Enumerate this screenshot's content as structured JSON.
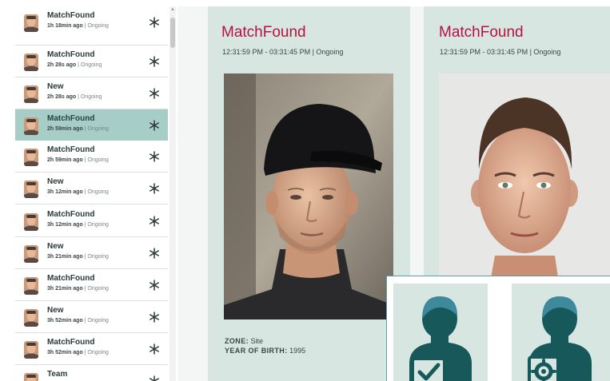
{
  "event_list": {
    "items": [
      {
        "title": "MatchFound",
        "ago": "1h 18min ago",
        "status": "Ongoing",
        "active": false
      },
      {
        "title": "MatchFound",
        "ago": "2h 28s ago",
        "status": "Ongoing",
        "active": false
      },
      {
        "title": "New",
        "ago": "2h 28s ago",
        "status": "Ongoing",
        "active": false
      },
      {
        "title": "MatchFound",
        "ago": "2h 59min ago",
        "status": "Ongoing",
        "active": true
      },
      {
        "title": "MatchFound",
        "ago": "2h 59min ago",
        "status": "Ongoing",
        "active": false
      },
      {
        "title": "New",
        "ago": "3h 12min ago",
        "status": "Ongoing",
        "active": false
      },
      {
        "title": "MatchFound",
        "ago": "3h 12min ago",
        "status": "Ongoing",
        "active": false
      },
      {
        "title": "New",
        "ago": "3h 21min ago",
        "status": "Ongoing",
        "active": false
      },
      {
        "title": "MatchFound",
        "ago": "3h 21min ago",
        "status": "Ongoing",
        "active": false
      },
      {
        "title": "New",
        "ago": "3h 52min ago",
        "status": "Ongoing",
        "active": false
      },
      {
        "title": "MatchFound",
        "ago": "3h 52min ago",
        "status": "Ongoing",
        "active": false
      },
      {
        "title": "Team",
        "ago": "",
        "status": "",
        "active": false
      }
    ],
    "separator": " | ",
    "action_icon": "snowflake-icon",
    "thumbnail_icon": "person-thumbnail-icon"
  },
  "detail": {
    "left_card": {
      "title": "MatchFound",
      "subtitle": "12:31:59 PM - 03:31:45 PM | Ongoing",
      "zone_label": "ZONE:",
      "zone_value": "Site",
      "yob_label": "YEAR OF BIRTH:",
      "yob_value": "1995",
      "photo": "surveillance-face-photo"
    },
    "right_card": {
      "title": "MatchFound",
      "subtitle": "12:31:59 PM - 03:31:45 PM | Ongoing",
      "photo": "reference-face-photo"
    }
  },
  "overlay": {
    "cards": [
      {
        "icon": "person-verified-icon"
      },
      {
        "icon": "person-settings-icon"
      }
    ]
  },
  "colors": {
    "accent_title": "#b5123f",
    "card_bg": "#d8e6e2",
    "active_row": "#a6cec6",
    "silhouette_dark": "#17585a",
    "silhouette_head": "#3e8a9c"
  }
}
